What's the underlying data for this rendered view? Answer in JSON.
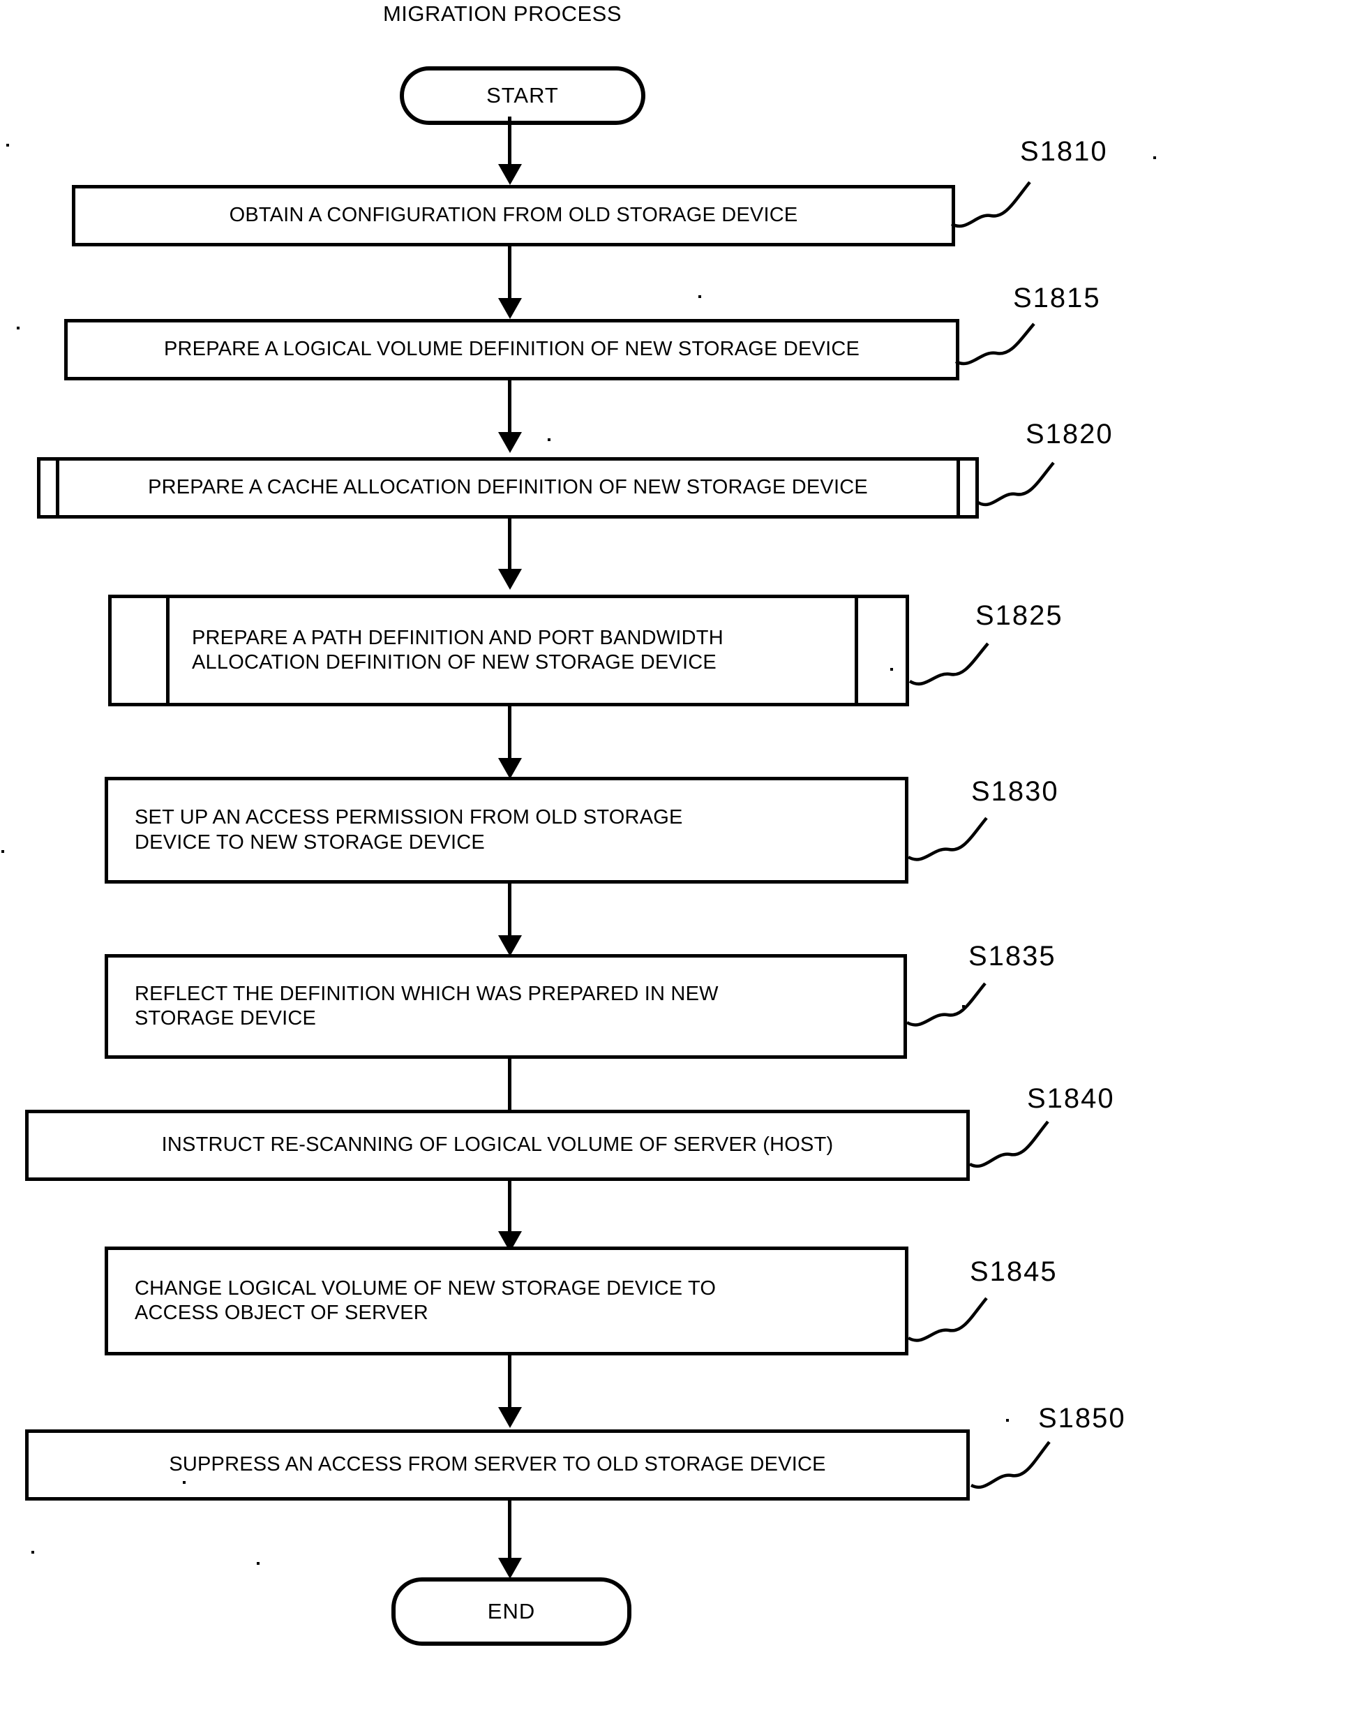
{
  "figure": {
    "title": "MIGRATION PROCESS",
    "type": "flowchart",
    "start_label": "START",
    "end_label": "END"
  },
  "steps": [
    {
      "ref": "S1810",
      "shape": "process",
      "align": "center",
      "lines": [
        "OBTAIN A CONFIGURATION FROM OLD STORAGE DEVICE"
      ]
    },
    {
      "ref": "S1815",
      "shape": "process",
      "align": "center",
      "lines": [
        "PREPARE A LOGICAL VOLUME DEFINITION OF NEW STORAGE DEVICE"
      ]
    },
    {
      "ref": "S1820",
      "shape": "predefined-process",
      "align": "center",
      "lines": [
        "PREPARE A CACHE ALLOCATION DEFINITION OF NEW STORAGE DEVICE"
      ]
    },
    {
      "ref": "S1825",
      "shape": "predefined-process",
      "align": "left",
      "lines": [
        "PREPARE A PATH DEFINITION AND PORT BANDWIDTH",
        "ALLOCATION DEFINITION OF NEW STORAGE DEVICE"
      ]
    },
    {
      "ref": "S1830",
      "shape": "process",
      "align": "left",
      "lines": [
        "SET UP AN ACCESS PERMISSION FROM OLD STORAGE",
        "DEVICE TO NEW STORAGE DEVICE"
      ]
    },
    {
      "ref": "S1835",
      "shape": "process",
      "align": "left",
      "lines": [
        "REFLECT THE DEFINITION WHICH WAS PREPARED IN NEW",
        "STORAGE DEVICE"
      ]
    },
    {
      "ref": "S1840",
      "shape": "process",
      "align": "center",
      "lines": [
        "INSTRUCT RE-SCANNING OF LOGICAL VOLUME OF SERVER (HOST)"
      ]
    },
    {
      "ref": "S1845",
      "shape": "process",
      "align": "left",
      "lines": [
        "CHANGE LOGICAL VOLUME OF NEW STORAGE DEVICE TO",
        "ACCESS OBJECT OF SERVER"
      ]
    },
    {
      "ref": "S1850",
      "shape": "process",
      "align": "center",
      "lines": [
        "SUPPRESS AN ACCESS FROM SERVER TO OLD STORAGE DEVICE"
      ]
    }
  ],
  "colors": {
    "ink": "#000000",
    "paper": "#ffffff"
  }
}
